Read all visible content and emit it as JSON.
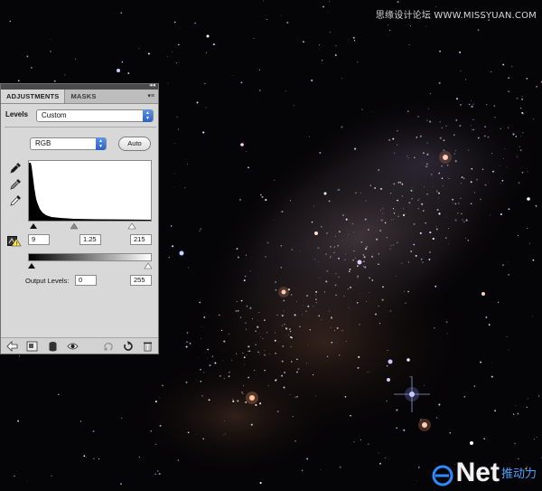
{
  "watermark": {
    "top": "思缘设计论坛 WWW.MISSYUAN.COM",
    "bottom_brand": "Net",
    "bottom_cn": "推动力"
  },
  "panel": {
    "tabs": [
      "ADJUSTMENTS",
      "MASKS"
    ],
    "active_tab": "ADJUSTMENTS",
    "preset_label": "Levels",
    "preset_value": "Custom",
    "channel_value": "RGB",
    "auto_label": "Auto",
    "input_levels": {
      "black": "9",
      "gamma": "1.25",
      "white": "215"
    },
    "output_label": "Output Levels:",
    "output_levels": {
      "black": "0",
      "white": "255"
    },
    "icons": {
      "eyedroppers": [
        "black-point-eyedropper-icon",
        "gray-point-eyedropper-icon",
        "white-point-eyedropper-icon"
      ],
      "bottom": [
        "back-arrow-icon",
        "expand-view-icon",
        "clip-to-layer-icon",
        "visibility-eye-icon",
        "view-previous-icon",
        "reset-icon",
        "trash-icon"
      ]
    }
  },
  "colors": {
    "panel_bg": "#d8d8d8",
    "select_arrow": "#3b74dc",
    "space_bg": "#050406"
  }
}
